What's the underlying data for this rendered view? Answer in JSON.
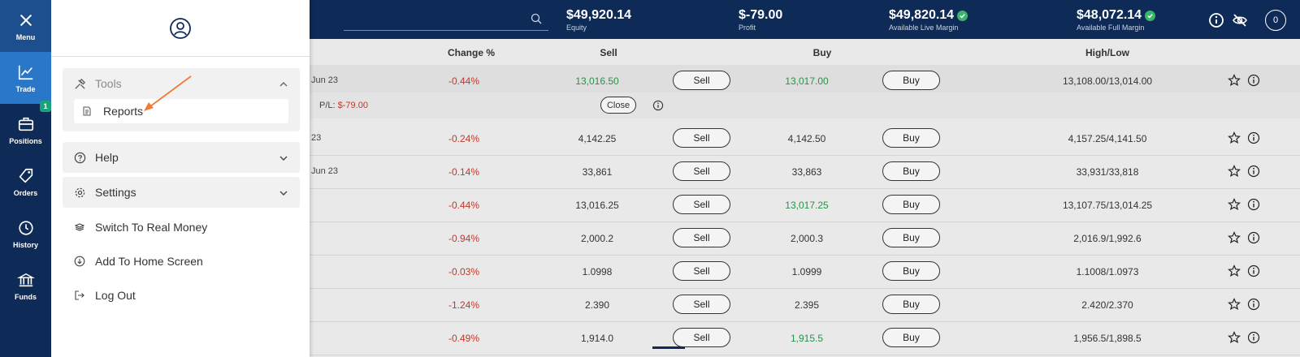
{
  "nav": [
    {
      "label": "Menu",
      "icon": "close-icon"
    },
    {
      "label": "Trade",
      "icon": "chart-line-icon"
    },
    {
      "label": "Positions",
      "icon": "briefcase-icon",
      "badge": "1"
    },
    {
      "label": "Orders",
      "icon": "tag-icon"
    },
    {
      "label": "History",
      "icon": "history-icon"
    },
    {
      "label": "Funds",
      "icon": "bank-icon"
    }
  ],
  "header": {
    "equity": {
      "value": "$49,920.14",
      "label": "Equity"
    },
    "profit": {
      "value": "$-79.00",
      "label": "Profit"
    },
    "live_margin": {
      "value": "$49,820.14",
      "label": "Available Live Margin"
    },
    "full_margin": {
      "value": "$48,072.14",
      "label": "Available Full Margin"
    },
    "account_initial": "0"
  },
  "menu": {
    "tools": {
      "label": "Tools",
      "items": [
        "Reports"
      ]
    },
    "help": {
      "label": "Help"
    },
    "settings": {
      "label": "Settings"
    },
    "switch_real": "Switch To Real Money",
    "add_home": "Add To Home Screen",
    "logout": "Log Out"
  },
  "table": {
    "columns": {
      "change": "Change %",
      "sell": "Sell",
      "buy": "Buy",
      "highlow": "High/Low"
    },
    "sell_label": "Sell",
    "buy_label": "Buy",
    "close_label": "Close",
    "pl_prefix": "P/L:",
    "pl_value": "$-79.00",
    "rows": [
      {
        "name": "Jun 23",
        "change": "-0.44%",
        "sell": "13,016.50",
        "buy": "13,017.00",
        "highlow": "13,108.00/13,014.00",
        "sell_color": "pos",
        "buy_color": "pos"
      },
      {
        "name": "23",
        "change": "-0.24%",
        "sell": "4,142.25",
        "buy": "4,142.50",
        "highlow": "4,157.25/4,141.50",
        "sell_color": "",
        "buy_color": ""
      },
      {
        "name": "Jun 23",
        "change": "-0.14%",
        "sell": "33,861",
        "buy": "33,863",
        "highlow": "33,931/33,818",
        "sell_color": "",
        "buy_color": ""
      },
      {
        "name": "",
        "change": "-0.44%",
        "sell": "13,016.25",
        "buy": "13,017.25",
        "highlow": "13,107.75/13,014.25",
        "sell_color": "",
        "buy_color": "pos"
      },
      {
        "name": "",
        "change": "-0.94%",
        "sell": "2,000.2",
        "buy": "2,000.3",
        "highlow": "2,016.9/1,992.6",
        "sell_color": "",
        "buy_color": ""
      },
      {
        "name": "",
        "change": "-0.03%",
        "sell": "1.0998",
        "buy": "1.0999",
        "highlow": "1.1008/1.0973",
        "sell_color": "",
        "buy_color": ""
      },
      {
        "name": "",
        "change": "-1.24%",
        "sell": "2.390",
        "buy": "2.395",
        "highlow": "2.420/2.370",
        "sell_color": "",
        "buy_color": ""
      },
      {
        "name": "",
        "change": "-0.49%",
        "sell": "1,914.0",
        "buy": "1,915.5",
        "highlow": "1,956.5/1,898.5",
        "sell_color": "",
        "buy_color": "pos"
      }
    ]
  }
}
